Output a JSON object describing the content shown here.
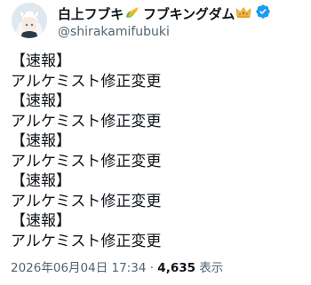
{
  "author": {
    "name_part1": "白上フブキ",
    "emoji1": "corn-emoji",
    "name_part2": "フブキングダム",
    "emoji2": "crown-emoji",
    "handle": "@shirakamifubuki",
    "verified_color": "#1d9bf0"
  },
  "tweet": {
    "lines": [
      "【速報】",
      "アルケミスト修正変更",
      "【速報】",
      "アルケミスト修正変更",
      "【速報】",
      "アルケミスト修正変更",
      "【速報】",
      "アルケミスト修正変更",
      "【速報】",
      "アルケミスト修正変更"
    ]
  },
  "meta": {
    "timestamp": "2026年06月04日 17:34",
    "separator": " · ",
    "views_count": "4,635",
    "views_label": " 表示"
  },
  "colors": {
    "text": "#0f1419",
    "secondary": "#536471",
    "accent": "#1d9bf0"
  }
}
